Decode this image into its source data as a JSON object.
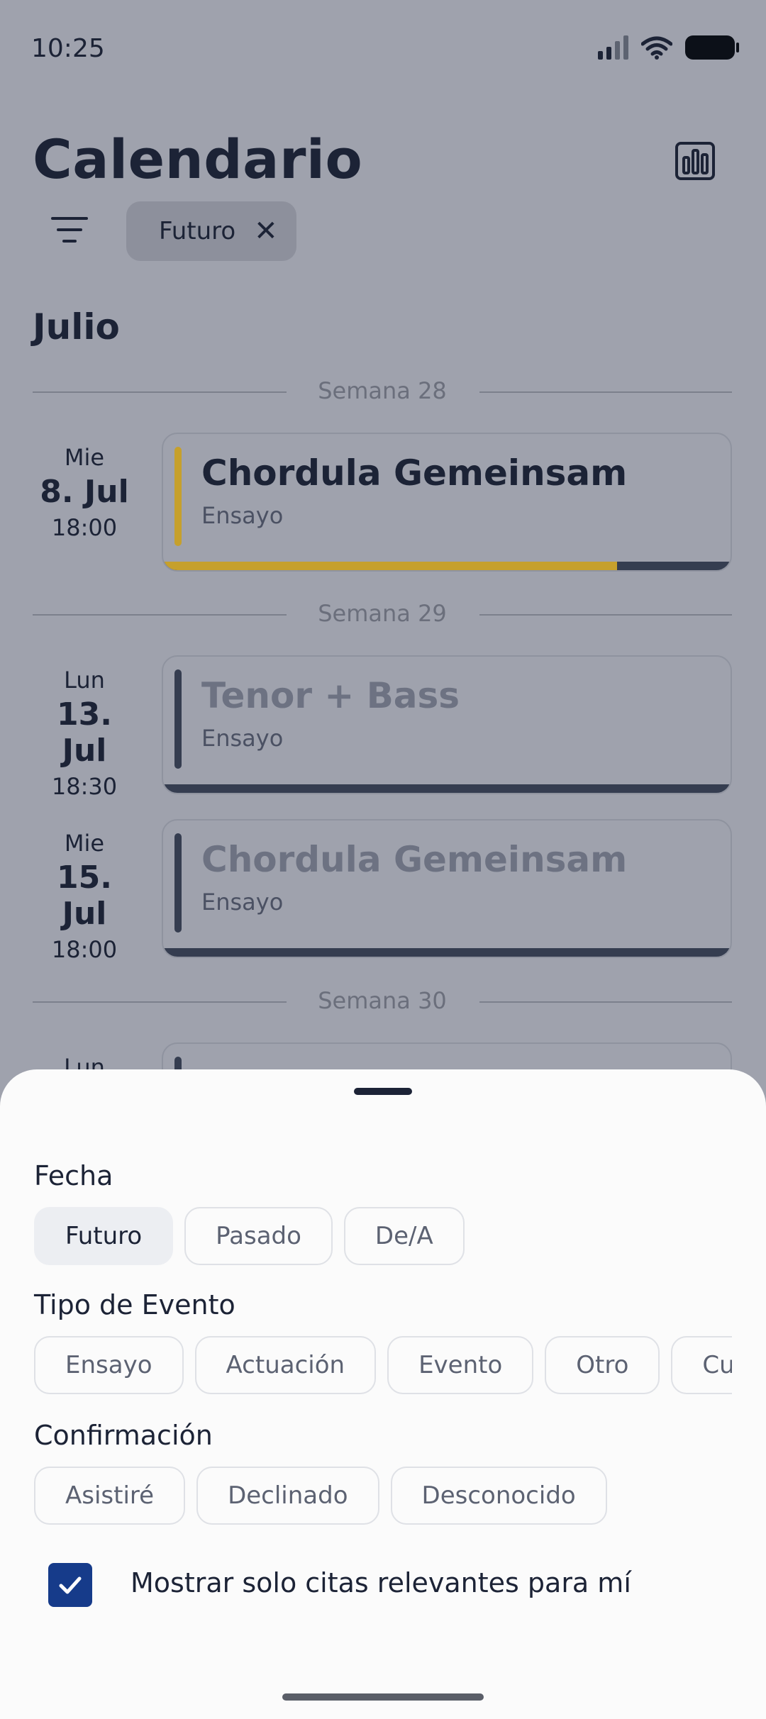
{
  "status": {
    "time": "10:25"
  },
  "header": {
    "title": "Calendario",
    "active_filter": "Futuro"
  },
  "month": "Julio",
  "weeks": [
    {
      "label": "Semana 28"
    },
    {
      "label": "Semana 29"
    },
    {
      "label": "Semana 30"
    }
  ],
  "events": [
    {
      "dow": "Mie",
      "date": "8. Jul",
      "time": "18:00",
      "title": "Chordula Gemeinsam",
      "type": "Ensayo",
      "accent": "#c6a02c",
      "progress": 0.8
    },
    {
      "dow": "Lun",
      "date": "13. Jul",
      "time": "18:30",
      "title": "Tenor + Bass",
      "type": "Ensayo",
      "accent": "#353d50",
      "progress": 0
    },
    {
      "dow": "Mie",
      "date": "15. Jul",
      "time": "18:00",
      "title": "Chordula Gemeinsam",
      "type": "Ensayo",
      "accent": "#353d50",
      "progress": 0
    },
    {
      "dow": "Lun"
    }
  ],
  "sheet": {
    "date_label": "Fecha",
    "date_options": [
      "Futuro",
      "Pasado",
      "De/A"
    ],
    "date_selected": "Futuro",
    "type_label": "Tipo de Evento",
    "type_options": [
      "Ensayo",
      "Actuación",
      "Evento",
      "Otro",
      "Cumpleaños"
    ],
    "confirm_label": "Confirmación",
    "confirm_options": [
      "Asistiré",
      "Declinado",
      "Desconocido"
    ],
    "checkbox_label": "Mostrar solo citas relevantes para mí",
    "checkbox_checked": true
  },
  "colors": {
    "accent_gold": "#c6a02c",
    "accent_navy": "#353d50",
    "checkbox": "#163b8a"
  },
  "icons": [
    "signal-icon",
    "wifi-icon",
    "battery-icon",
    "stats-icon",
    "filter-icon",
    "close-icon",
    "check-icon"
  ]
}
